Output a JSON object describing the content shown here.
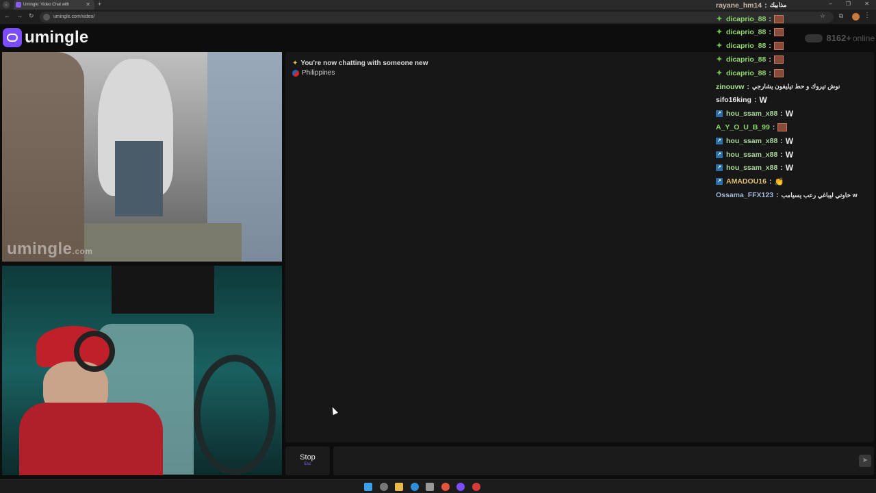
{
  "browser": {
    "tab_title": "Umingle: Video Chat with",
    "tab_close": "✕",
    "new_tab": "+",
    "url": "umingle.com/video/",
    "win_minimize": "–",
    "win_restore": "❐",
    "win_close": "✕"
  },
  "site": {
    "logo_text": "umingle",
    "online_count": "8162+",
    "online_label": "online"
  },
  "video": {
    "watermark_main": "umingle",
    "watermark_suffix": ".com"
  },
  "chat": {
    "system_message": "You're now chatting with someone new",
    "partner_country": "Philippines"
  },
  "stream_chat": [
    {
      "icon": "none",
      "user": "rayane_hm14",
      "user_color": "#c9b7a6",
      "text": "مذابيك",
      "kind": "text"
    },
    {
      "icon": "plus",
      "user": "dicaprio_88",
      "user_color": "#8fd66a",
      "text": "",
      "kind": "pic"
    },
    {
      "icon": "plus",
      "user": "dicaprio_88",
      "user_color": "#8fd66a",
      "text": "",
      "kind": "pic"
    },
    {
      "icon": "plus",
      "user": "dicaprio_88",
      "user_color": "#8fd66a",
      "text": "",
      "kind": "pic"
    },
    {
      "icon": "plus",
      "user": "dicaprio_88",
      "user_color": "#8fd66a",
      "text": "",
      "kind": "pic"
    },
    {
      "icon": "plus",
      "user": "dicaprio_88",
      "user_color": "#8fd66a",
      "text": "",
      "kind": "pic"
    },
    {
      "icon": "none",
      "user": "zinouvw",
      "user_color": "#a4e08a",
      "text": "نوش تيروك و حط تيليفون يشارجي",
      "kind": "text"
    },
    {
      "icon": "none",
      "user": "sifo16king",
      "user_color": "#e8e8e8",
      "text": "W",
      "kind": "w"
    },
    {
      "icon": "arrow",
      "user": "hou_ssam_x88",
      "user_color": "#a9d89a",
      "text": "W",
      "kind": "w"
    },
    {
      "icon": "none",
      "user": "A_Y_O_U_B_99",
      "user_color": "#8fd66a",
      "text": "",
      "kind": "pic"
    },
    {
      "icon": "arrow",
      "user": "hou_ssam_x88",
      "user_color": "#a9d89a",
      "text": "W",
      "kind": "w"
    },
    {
      "icon": "arrow",
      "user": "hou_ssam_x88",
      "user_color": "#a9d89a",
      "text": "W",
      "kind": "w"
    },
    {
      "icon": "arrow",
      "user": "hou_ssam_x88",
      "user_color": "#a9d89a",
      "text": "W",
      "kind": "w"
    },
    {
      "icon": "arrow",
      "user": "AMADOU16",
      "user_color": "#e0c070",
      "text": "👏",
      "kind": "emoji"
    },
    {
      "icon": "none",
      "user": "Ossama_FFX123",
      "user_color": "#9fb8d8",
      "text": "خاوتي ليباغي رعب يسيامب w",
      "kind": "text"
    }
  ],
  "controls": {
    "stop_label": "Stop",
    "stop_key": "Esc",
    "message_placeholder": "",
    "send_icon": "send-icon"
  },
  "colors": {
    "accent": "#7c4dff",
    "panel": "#171717",
    "background": "#0d0d0d"
  }
}
